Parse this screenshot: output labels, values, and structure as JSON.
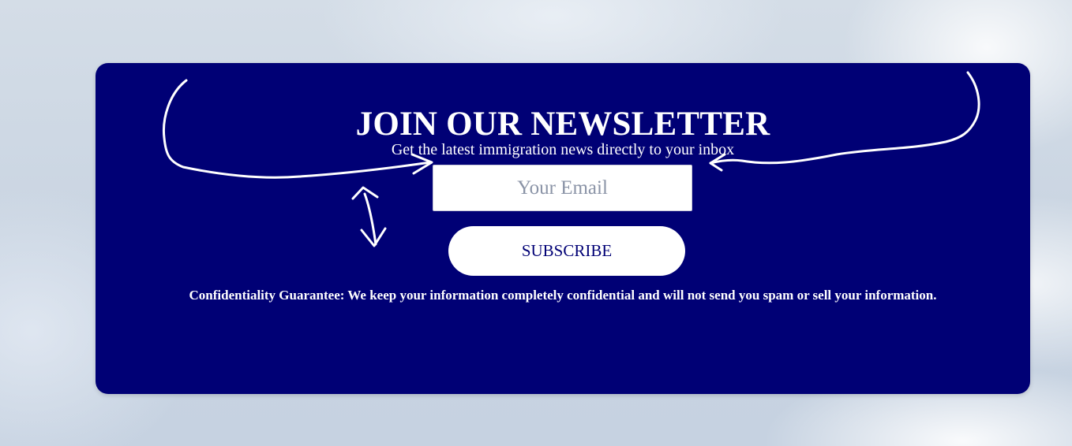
{
  "newsletter": {
    "title": "JOIN OUR NEWSLETTER",
    "subtitle": "Get the latest immigration news directly to your inbox",
    "email_placeholder": "Your Email",
    "email_value": "",
    "subscribe_label": "SUBSCRIBE",
    "confidentiality_note": "Confidentiality Guarantee: We keep your information completely confidential and will not send you spam or sell your information."
  },
  "colors": {
    "card_background": "#000075",
    "text": "#ffffff",
    "button_background": "#ffffff",
    "button_text": "#000075",
    "annotation_stroke": "#ffffff"
  },
  "annotations": {
    "icons": [
      "left-curved-arrow-icon",
      "right-curved-arrow-icon",
      "vertical-double-arrow-icon"
    ]
  }
}
